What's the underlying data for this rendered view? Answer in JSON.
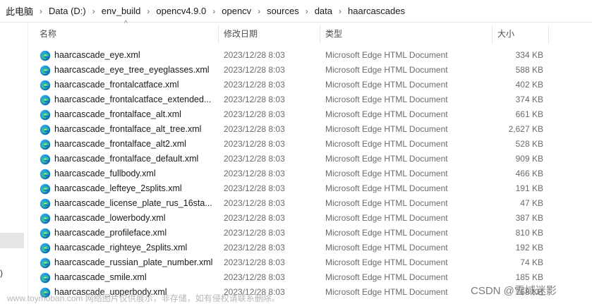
{
  "breadcrumb": [
    "此电脑",
    "Data (D:)",
    "env_build",
    "opencv4.9.0",
    "opencv",
    "sources",
    "data",
    "haarcascades"
  ],
  "breadcrumb_separator": "›",
  "nav": {
    "cutoff_text": ")"
  },
  "columns": {
    "name": "名称",
    "date": "修改日期",
    "type": "类型",
    "size": "大小",
    "sort_arrow": "^"
  },
  "files": [
    {
      "name": "haarcascade_eye.xml",
      "date": "2023/12/28 8:03",
      "type": "Microsoft Edge HTML Document",
      "size": "334 KB"
    },
    {
      "name": "haarcascade_eye_tree_eyeglasses.xml",
      "date": "2023/12/28 8:03",
      "type": "Microsoft Edge HTML Document",
      "size": "588 KB"
    },
    {
      "name": "haarcascade_frontalcatface.xml",
      "date": "2023/12/28 8:03",
      "type": "Microsoft Edge HTML Document",
      "size": "402 KB"
    },
    {
      "name": "haarcascade_frontalcatface_extended...",
      "date": "2023/12/28 8:03",
      "type": "Microsoft Edge HTML Document",
      "size": "374 KB"
    },
    {
      "name": "haarcascade_frontalface_alt.xml",
      "date": "2023/12/28 8:03",
      "type": "Microsoft Edge HTML Document",
      "size": "661 KB"
    },
    {
      "name": "haarcascade_frontalface_alt_tree.xml",
      "date": "2023/12/28 8:03",
      "type": "Microsoft Edge HTML Document",
      "size": "2,627 KB"
    },
    {
      "name": "haarcascade_frontalface_alt2.xml",
      "date": "2023/12/28 8:03",
      "type": "Microsoft Edge HTML Document",
      "size": "528 KB"
    },
    {
      "name": "haarcascade_frontalface_default.xml",
      "date": "2023/12/28 8:03",
      "type": "Microsoft Edge HTML Document",
      "size": "909 KB"
    },
    {
      "name": "haarcascade_fullbody.xml",
      "date": "2023/12/28 8:03",
      "type": "Microsoft Edge HTML Document",
      "size": "466 KB"
    },
    {
      "name": "haarcascade_lefteye_2splits.xml",
      "date": "2023/12/28 8:03",
      "type": "Microsoft Edge HTML Document",
      "size": "191 KB"
    },
    {
      "name": "haarcascade_license_plate_rus_16sta...",
      "date": "2023/12/28 8:03",
      "type": "Microsoft Edge HTML Document",
      "size": "47 KB"
    },
    {
      "name": "haarcascade_lowerbody.xml",
      "date": "2023/12/28 8:03",
      "type": "Microsoft Edge HTML Document",
      "size": "387 KB"
    },
    {
      "name": "haarcascade_profileface.xml",
      "date": "2023/12/28 8:03",
      "type": "Microsoft Edge HTML Document",
      "size": "810 KB"
    },
    {
      "name": "haarcascade_righteye_2splits.xml",
      "date": "2023/12/28 8:03",
      "type": "Microsoft Edge HTML Document",
      "size": "192 KB"
    },
    {
      "name": "haarcascade_russian_plate_number.xml",
      "date": "2023/12/28 8:03",
      "type": "Microsoft Edge HTML Document",
      "size": "74 KB"
    },
    {
      "name": "haarcascade_smile.xml",
      "date": "2023/12/28 8:03",
      "type": "Microsoft Edge HTML Document",
      "size": "185 KB"
    },
    {
      "name": "haarcascade_upperbody.xml",
      "date": "2023/12/28 8:03",
      "type": "Microsoft Edge HTML Document",
      "size": "768 KB"
    }
  ],
  "file_icon": "edge-html-icon",
  "watermarks": {
    "left": "www.toymoban.com 网络图片仅供展示，非存储，如有侵权请联系删除。",
    "right": "CSDN @雪域迷影"
  },
  "colors": {
    "edge_blue": "#1b7fd6",
    "edge_green": "#37c77f",
    "selected_bg": "#e5e5e5"
  }
}
